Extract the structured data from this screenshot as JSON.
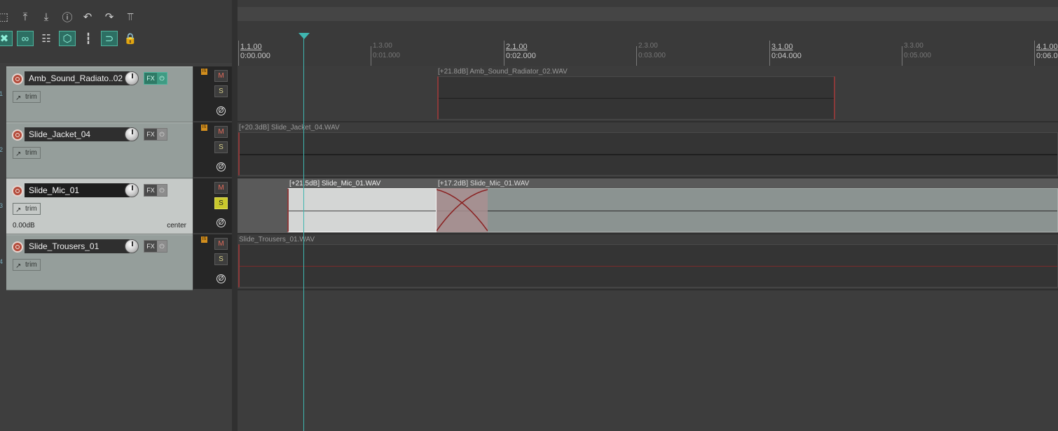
{
  "toolbar": {
    "row1": [
      {
        "name": "new-project-icon",
        "glyph": "⬚"
      },
      {
        "name": "open-project-icon",
        "glyph": "⤒"
      },
      {
        "name": "save-project-icon",
        "glyph": "⤓"
      },
      {
        "name": "project-settings-icon",
        "glyph": "ⓘ"
      },
      {
        "name": "undo-icon",
        "glyph": "↶"
      },
      {
        "name": "redo-icon",
        "glyph": "↷"
      },
      {
        "name": "metronome-icon",
        "glyph": "⫪"
      }
    ],
    "row2": [
      {
        "name": "ripple-edit-icon",
        "glyph": "✖"
      },
      {
        "name": "item-grouping-icon",
        "glyph": "∞"
      },
      {
        "name": "grid-icon",
        "glyph": "☷"
      },
      {
        "name": "envelope-lock-icon",
        "glyph": "⬡"
      },
      {
        "name": "snap-lines-icon",
        "glyph": "┇"
      },
      {
        "name": "snap-icon",
        "glyph": "⊃"
      },
      {
        "name": "lock-icon",
        "glyph": "ὑ2"
      }
    ]
  },
  "ruler": {
    "major": [
      {
        "bar": "1.1.00",
        "time": "0:00.000"
      },
      {
        "bar": "2.1.00",
        "time": "0:02.000"
      },
      {
        "bar": "3.1.00",
        "time": "0:04.000"
      },
      {
        "bar": "4.1.00",
        "time": "0:06.0"
      }
    ],
    "minor": [
      {
        "bar": "1.3.00",
        "time": "0:01.000"
      },
      {
        "bar": "2.3.00",
        "time": "0:03.000"
      },
      {
        "bar": "3.3.00",
        "time": "0:05.000"
      }
    ]
  },
  "tracks": [
    {
      "number": "1",
      "name": "Amb_Sound_Radiato..02",
      "fx_label": "FX",
      "power": "⏻",
      "trim": "trim",
      "mute": "M",
      "solo": "S",
      "phase": "Ø",
      "fx_active": true,
      "item": {
        "label": "[+21.8dB] Amb_Sound_Radiator_02.WAV"
      }
    },
    {
      "number": "2",
      "name": "Slide_Jacket_04",
      "fx_label": "FX",
      "power": "⏻",
      "trim": "trim",
      "mute": "M",
      "solo": "S",
      "phase": "Ø",
      "item": {
        "label": "[+20.3dB] Slide_Jacket_04.WAV"
      }
    },
    {
      "number": "3",
      "name": "Slide_Mic_01",
      "fx_label": "FX",
      "power": "⏻",
      "trim": "trim",
      "mute": "M",
      "solo": "S",
      "phase": "Ø",
      "volume": "0.00dB",
      "pan": "center",
      "selected": true,
      "solo_on": true,
      "item": {
        "label": "[+21.5dB] Slide_Mic_01.WAV",
        "label2": "[+17.2dB] Slide_Mic_01.WAV"
      }
    },
    {
      "number": "4",
      "name": "Slide_Trousers_01",
      "fx_label": "FX",
      "power": "⏻",
      "trim": "trim",
      "mute": "M",
      "solo": "S",
      "phase": "Ø",
      "item": {
        "label": "Slide_Trousers_01.WAV"
      }
    }
  ],
  "colors": {
    "playhead": "#3fb6b0",
    "solo_on": "#c9c82c",
    "fx_active": "#2f7a66",
    "rec_arm": "#b34b3a"
  }
}
